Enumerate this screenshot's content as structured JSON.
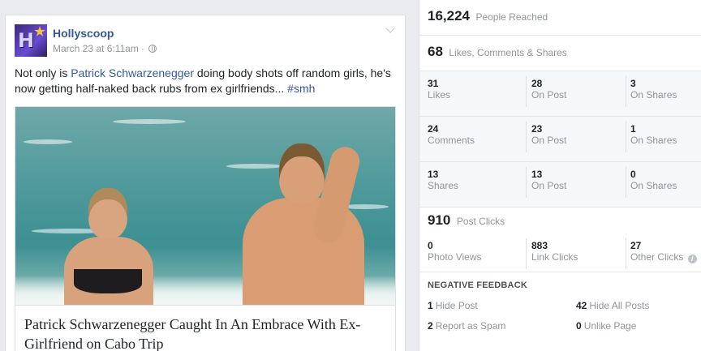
{
  "post": {
    "page_name": "Hollyscoop",
    "timestamp": "March 23 at 6:11am",
    "separator": "·",
    "text_before": "Not only is ",
    "text_link": "Patrick Schwarzenegger",
    "text_after": " doing body shots off random girls, he's now getting half-naked back rubs from ex girlfriends... ",
    "hashtag": "#smh",
    "link_title": "Patrick Schwarzenegger Caught In An Embrace With Ex-Girlfriend on Cabo Trip",
    "avatar_letters": "H"
  },
  "insights": {
    "reach": {
      "value": "16,224",
      "label": "People Reached"
    },
    "engagement": {
      "value": "68",
      "label": "Likes, Comments & Shares"
    },
    "likes": [
      {
        "value": "31",
        "label": "Likes"
      },
      {
        "value": "28",
        "label": "On Post"
      },
      {
        "value": "3",
        "label": "On Shares"
      }
    ],
    "comments": [
      {
        "value": "24",
        "label": "Comments"
      },
      {
        "value": "23",
        "label": "On Post"
      },
      {
        "value": "1",
        "label": "On Shares"
      }
    ],
    "shares": [
      {
        "value": "13",
        "label": "Shares"
      },
      {
        "value": "13",
        "label": "On Post"
      },
      {
        "value": "0",
        "label": "On Shares"
      }
    ],
    "post_clicks": {
      "value": "910",
      "label": "Post Clicks"
    },
    "clicks": [
      {
        "value": "0",
        "label": "Photo Views"
      },
      {
        "value": "883",
        "label": "Link Clicks"
      },
      {
        "value": "27",
        "label": "Other Clicks"
      }
    ],
    "negative": {
      "heading": "NEGATIVE FEEDBACK",
      "hide_post": {
        "value": "1",
        "label": "Hide Post"
      },
      "hide_all": {
        "value": "42",
        "label": "Hide All Posts"
      },
      "spam": {
        "value": "2",
        "label": "Report as Spam"
      },
      "unlike": {
        "value": "0",
        "label": "Unlike Page"
      }
    },
    "info_glyph": "i"
  },
  "colors": {
    "link": "#365899",
    "muted": "#90949c",
    "background": "#e9ebee"
  }
}
